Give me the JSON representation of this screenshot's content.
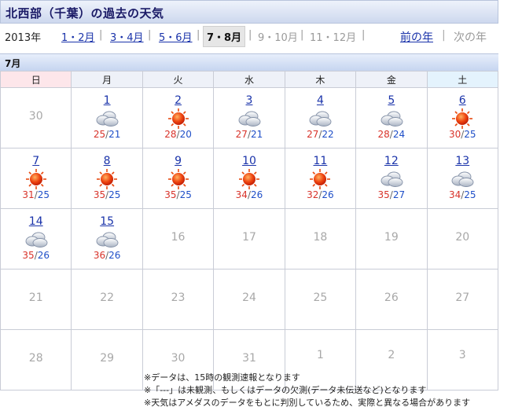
{
  "header": {
    "title": "北西部（千葉）の過去の天気"
  },
  "period_nav": {
    "year_label": "2013年",
    "periods": [
      {
        "label": "1・2月",
        "state": "link"
      },
      {
        "label": "3・4月",
        "state": "link"
      },
      {
        "label": "5・6月",
        "state": "link"
      },
      {
        "label": "7・8月",
        "state": "current"
      },
      {
        "label": "9・10月",
        "state": "disabled"
      },
      {
        "label": "11・12月",
        "state": "disabled"
      }
    ],
    "separator": "|",
    "prev_year": "前の年",
    "year_divider": "|",
    "next_year": "次の年"
  },
  "calendar": {
    "month_label": "7月",
    "weekdays": [
      "日",
      "月",
      "火",
      "水",
      "木",
      "金",
      "土"
    ],
    "weeks": [
      [
        {
          "day": "30",
          "kind": "plain"
        },
        {
          "day": "1",
          "kind": "link",
          "icon": "cloudy-icon",
          "max": "25",
          "min": "21"
        },
        {
          "day": "2",
          "kind": "link",
          "icon": "sunny-icon",
          "max": "28",
          "min": "20"
        },
        {
          "day": "3",
          "kind": "link",
          "icon": "cloudy-icon",
          "max": "27",
          "min": "21"
        },
        {
          "day": "4",
          "kind": "link",
          "icon": "cloudy-icon",
          "max": "27",
          "min": "22"
        },
        {
          "day": "5",
          "kind": "link",
          "icon": "cloudy-icon",
          "max": "28",
          "min": "24"
        },
        {
          "day": "6",
          "kind": "link",
          "icon": "sunny-icon",
          "max": "30",
          "min": "25"
        }
      ],
      [
        {
          "day": "7",
          "kind": "link",
          "icon": "sunny-icon",
          "max": "31",
          "min": "25"
        },
        {
          "day": "8",
          "kind": "link",
          "icon": "sunny-icon",
          "max": "35",
          "min": "25"
        },
        {
          "day": "9",
          "kind": "link",
          "icon": "sunny-icon",
          "max": "35",
          "min": "25"
        },
        {
          "day": "10",
          "kind": "link",
          "icon": "sunny-icon",
          "max": "34",
          "min": "26"
        },
        {
          "day": "11",
          "kind": "link",
          "icon": "sunny-icon",
          "max": "32",
          "min": "26"
        },
        {
          "day": "12",
          "kind": "link",
          "icon": "cloudy-icon",
          "max": "35",
          "min": "27"
        },
        {
          "day": "13",
          "kind": "link",
          "icon": "cloudy-icon",
          "max": "34",
          "min": "25"
        }
      ],
      [
        {
          "day": "14",
          "kind": "link",
          "icon": "cloudy-icon",
          "max": "35",
          "min": "26"
        },
        {
          "day": "15",
          "kind": "link",
          "icon": "cloudy-icon",
          "max": "36",
          "min": "26"
        },
        {
          "day": "16",
          "kind": "plain"
        },
        {
          "day": "17",
          "kind": "plain"
        },
        {
          "day": "18",
          "kind": "plain"
        },
        {
          "day": "19",
          "kind": "plain"
        },
        {
          "day": "20",
          "kind": "plain"
        }
      ],
      [
        {
          "day": "21",
          "kind": "plain"
        },
        {
          "day": "22",
          "kind": "plain"
        },
        {
          "day": "23",
          "kind": "plain"
        },
        {
          "day": "24",
          "kind": "plain"
        },
        {
          "day": "25",
          "kind": "plain"
        },
        {
          "day": "26",
          "kind": "plain"
        },
        {
          "day": "27",
          "kind": "plain"
        }
      ],
      [
        {
          "day": "28",
          "kind": "plain"
        },
        {
          "day": "29",
          "kind": "plain"
        },
        {
          "day": "30",
          "kind": "plain"
        },
        {
          "day": "31",
          "kind": "plain"
        },
        {
          "day": "1",
          "kind": "next"
        },
        {
          "day": "2",
          "kind": "next"
        },
        {
          "day": "3",
          "kind": "next"
        }
      ]
    ],
    "temp_separator": "/"
  },
  "notes": [
    "※データは、15時の観測速報となります",
    "※「---」は未観測、もしくはデータの欠測(データ未伝送など)となります",
    "※天気はアメダスのデータをもとに判別しているため、実際と異なる場合があります"
  ],
  "colors": {
    "max_temp": "#d8332a",
    "min_temp": "#1f4fc8",
    "link": "#1a33aa"
  }
}
